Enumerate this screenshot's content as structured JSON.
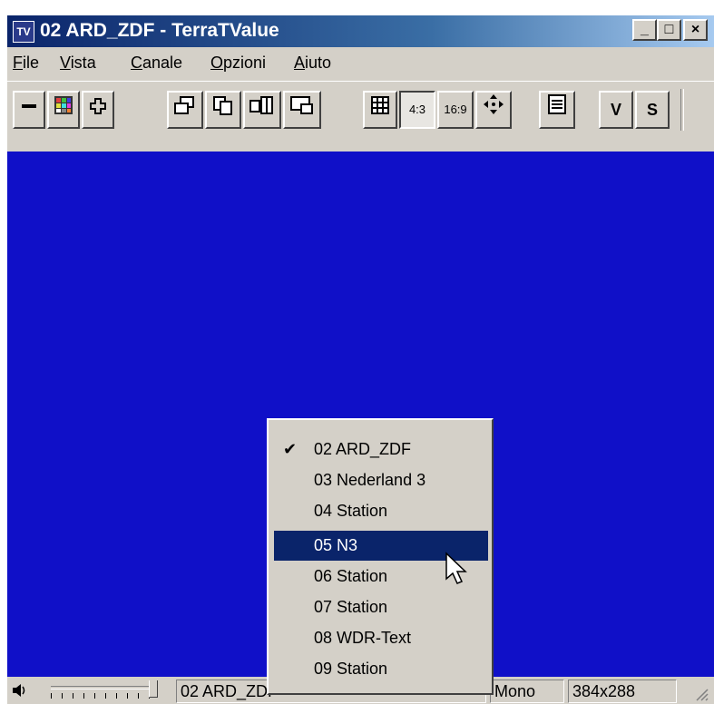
{
  "window": {
    "title": "02 ARD_ZDF - TerraTValue",
    "icon": "tv-app-icon"
  },
  "menu": [
    "File",
    "Vista",
    "Canale",
    "Opzioni",
    "Aiuto"
  ],
  "toolbar": {
    "aspect_43": "4:3",
    "aspect_169": "16:9",
    "v_label": "V",
    "s_label": "S"
  },
  "channel_menu": {
    "items": [
      "02 ARD_ZDF",
      "03 Nederland 3",
      "04 Station",
      "05 N3",
      "06 Station",
      "07 Station",
      "08 WDR-Text",
      "09 Station"
    ],
    "checked": "02 ARD_ZDF",
    "highlighted": "05 N3"
  },
  "statusbar": {
    "channel": "02 ARD_ZDF",
    "audio": "Mono",
    "resolution": "384x288"
  },
  "colors": {
    "video_bg": "#1010c8",
    "highlight": "#0a246a",
    "face": "#d4d0c8"
  }
}
